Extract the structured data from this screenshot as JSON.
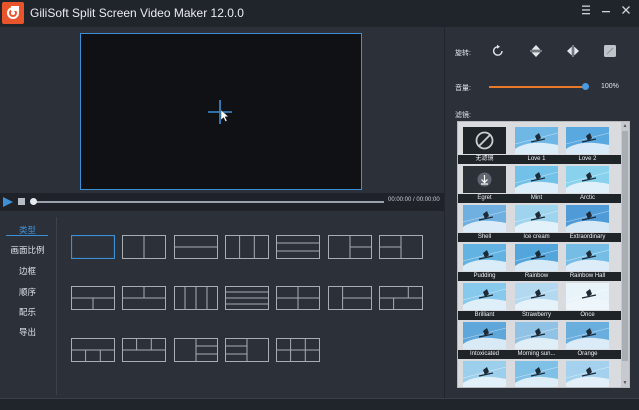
{
  "app": {
    "title": "GiliSoft Split Screen Video Maker 12.0.0",
    "icon": "app-logo-icon",
    "window_controls": [
      "settings-icon",
      "minimize-icon",
      "close-icon"
    ]
  },
  "player": {
    "time_display": "00:00:00 / 00:00:00",
    "progress": 0
  },
  "nav": {
    "items": [
      {
        "label": "类型",
        "active": true
      },
      {
        "label": "画面比例",
        "active": false
      },
      {
        "label": "边框",
        "active": false
      },
      {
        "label": "顺序",
        "active": false
      },
      {
        "label": "配乐",
        "active": false
      },
      {
        "label": "导出",
        "active": false
      }
    ]
  },
  "layouts": {
    "count": 19,
    "selected_index": 0
  },
  "right_panel": {
    "rotate_label": "旋转:",
    "rotate_tools": [
      "rotate-icon",
      "flip-vertical-icon",
      "flip-horizontal-icon",
      "crop-icon"
    ],
    "volume_label": "音量:",
    "volume_value": "100%",
    "volume_level": 1.0,
    "filters_label": "滤镜:",
    "filters": [
      "无滤镜",
      "Love 1",
      "Love 2",
      "Egret",
      "Mint",
      "Arctic",
      "Shell",
      "Ice cream",
      "Extraordinary",
      "Pudding",
      "Rainbow",
      "Rainbow Hall",
      "Brilliant",
      "Strawberry",
      "Once",
      "Intoxicated",
      "Morning sun...",
      "Orange",
      "",
      "",
      ""
    ]
  },
  "colors": {
    "accent": "#3d8fd6",
    "volume": "#e97a2a",
    "background": "#2b3039",
    "titlebar": "#20242b"
  }
}
